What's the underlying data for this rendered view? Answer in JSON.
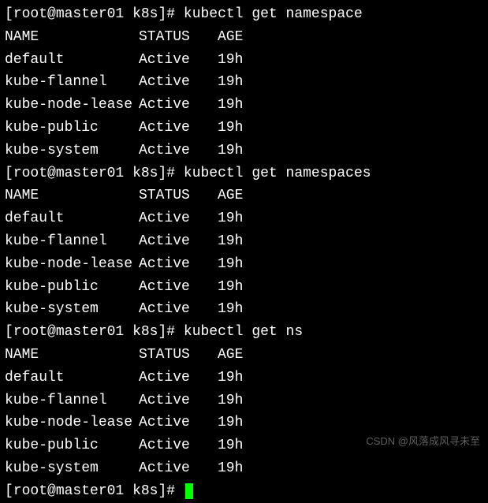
{
  "prompt": {
    "user_host": "root@master01",
    "path": "k8s",
    "symbol": "#"
  },
  "commands": {
    "cmd1": "kubectl get namespace",
    "cmd2": "kubectl get namespaces",
    "cmd3": "kubectl get ns"
  },
  "headers": {
    "name": "NAME",
    "status": "STATUS",
    "age": "AGE"
  },
  "rows": [
    {
      "name": "default",
      "status": "Active",
      "age": "19h"
    },
    {
      "name": "kube-flannel",
      "status": "Active",
      "age": "19h"
    },
    {
      "name": "kube-node-lease",
      "status": "Active",
      "age": "19h"
    },
    {
      "name": "kube-public",
      "status": "Active",
      "age": "19h"
    },
    {
      "name": "kube-system",
      "status": "Active",
      "age": "19h"
    }
  ],
  "watermark": "CSDN @风落成风寻未至"
}
